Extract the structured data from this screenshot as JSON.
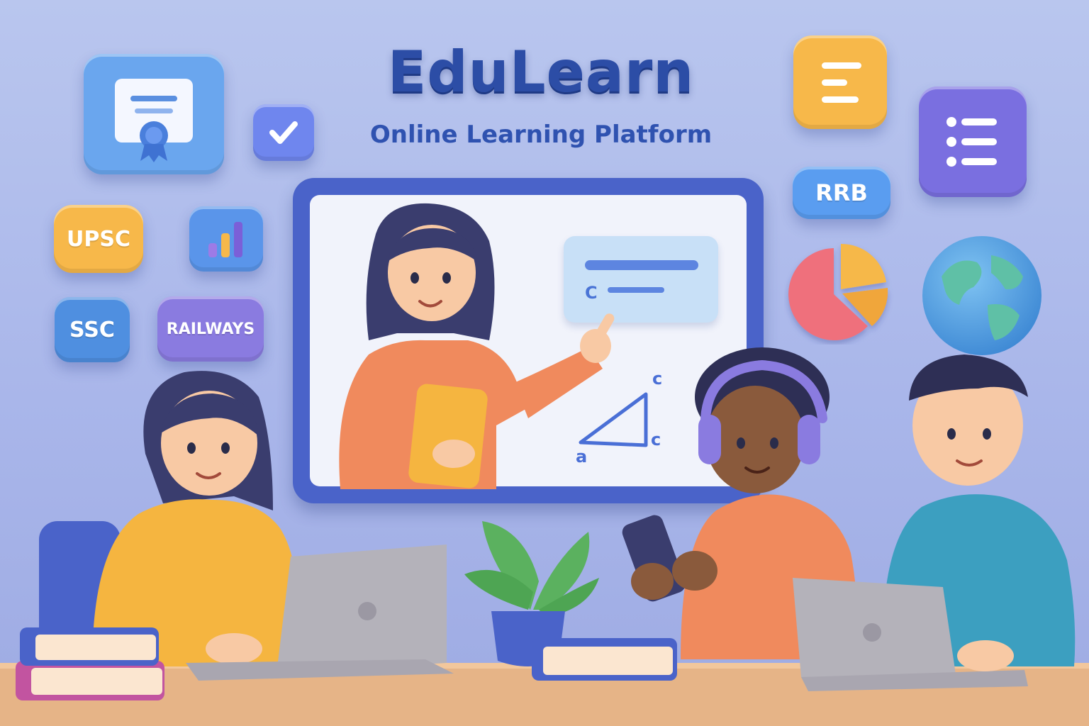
{
  "brand": {
    "title": "EduLearn",
    "subtitle": "Online Learning Platform"
  },
  "badges": {
    "upsc": "UPSC",
    "ssc": "SSC",
    "railways": "RAILWAYS",
    "rrb": "RRB"
  },
  "board": {
    "card_label": "C",
    "triangle_labels": {
      "top": "c",
      "right": "c",
      "left": "a"
    }
  },
  "icons": {
    "certificate": "certificate-icon",
    "checkbox": "checkbox-icon",
    "bar_chart": "bar-chart-icon",
    "text_document": "text-document-icon",
    "list": "list-icon",
    "pie_chart": "pie-chart-icon",
    "globe": "globe-icon"
  },
  "colors": {
    "brand": "#2c4da6",
    "background": "#b3c0ec",
    "upsc_tile": "#f7b84a",
    "ssc_tile": "#4f8fe0",
    "railways_tile": "#8a7be0",
    "rrb_tile": "#5a9df0",
    "board_frame": "#4a63c9"
  }
}
